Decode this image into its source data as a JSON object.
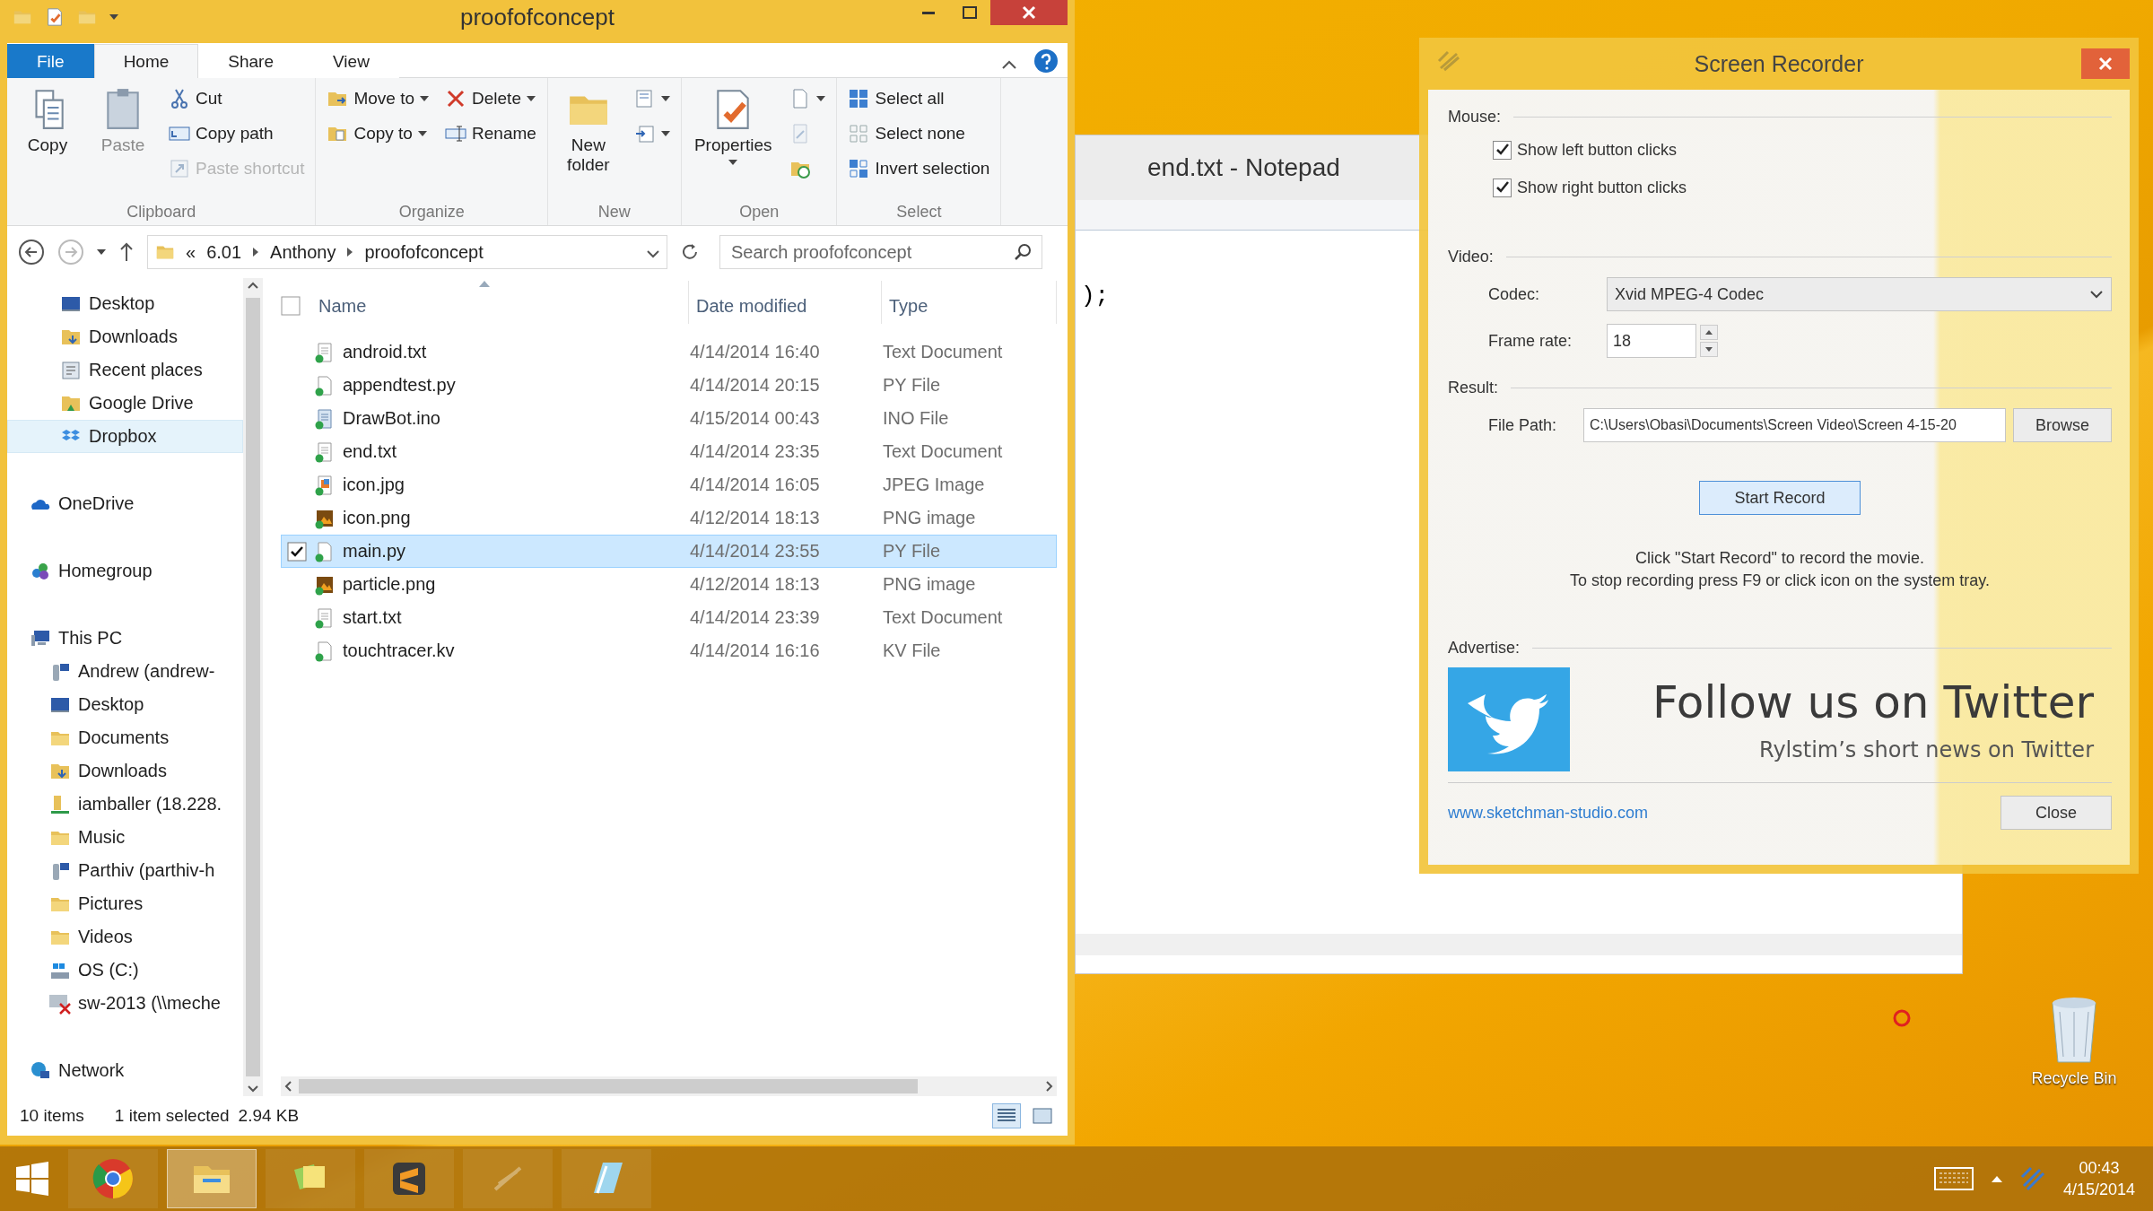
{
  "explorer": {
    "title": "proofofconcept",
    "tabs": [
      {
        "label": "File",
        "selected": false,
        "kind": "file"
      },
      {
        "label": "Home",
        "selected": true,
        "kind": "tab"
      },
      {
        "label": "Share",
        "selected": false,
        "kind": "tab"
      },
      {
        "label": "View",
        "selected": false,
        "kind": "tab"
      }
    ],
    "ribbon": [
      {
        "label": "Clipboard",
        "items": [
          {
            "kind": "large",
            "label": "Copy",
            "disabled": false,
            "dropdown": false
          },
          {
            "kind": "large",
            "label": "Paste",
            "disabled": true,
            "dropdown": false
          },
          {
            "kind": "column",
            "items": [
              {
                "label": "Cut",
                "disabled": false,
                "dropdown": false
              },
              {
                "label": "Copy path",
                "disabled": false,
                "dropdown": false
              },
              {
                "label": "Paste shortcut",
                "disabled": true,
                "dropdown": false
              }
            ]
          }
        ]
      },
      {
        "label": "Organize",
        "items": [
          {
            "kind": "column",
            "items": [
              {
                "label": "Move to",
                "disabled": false,
                "dropdown": true
              },
              {
                "label": "Copy to",
                "disabled": false,
                "dropdown": true
              }
            ]
          },
          {
            "kind": "column",
            "items": [
              {
                "label": "Delete",
                "disabled": false,
                "dropdown": true
              },
              {
                "label": "Rename",
                "disabled": false,
                "dropdown": false
              }
            ]
          }
        ]
      },
      {
        "label": "New",
        "items": [
          {
            "kind": "large",
            "label": "New folder",
            "disabled": false,
            "dropdown": false
          },
          {
            "kind": "column",
            "items": [
              {
                "disabled": false,
                "dropdown": true
              },
              {
                "disabled": false,
                "dropdown": true
              }
            ]
          }
        ]
      },
      {
        "label": "Open",
        "items": [
          {
            "kind": "large",
            "label": "Properties",
            "disabled": false,
            "dropdown": true
          },
          {
            "kind": "column",
            "items": [
              {
                "disabled": false,
                "dropdown": true
              },
              {
                "disabled": true,
                "dropdown": false
              },
              {
                "disabled": false,
                "dropdown": false
              }
            ]
          }
        ]
      },
      {
        "label": "Select",
        "items": [
          {
            "kind": "column",
            "items": [
              {
                "label": "Select all",
                "disabled": false,
                "dropdown": false
              },
              {
                "label": "Select none",
                "disabled": false,
                "dropdown": false
              },
              {
                "label": "Invert selection",
                "disabled": false,
                "dropdown": false
              }
            ]
          }
        ]
      }
    ],
    "address": {
      "overflow": "«",
      "crumbs": [
        "6.01",
        "Anthony",
        "proofofconcept"
      ],
      "search_placeholder": "Search proofofconcept"
    },
    "nav": [
      {
        "children": [
          {
            "label": "Desktop",
            "kind": "desktop",
            "selected": false
          },
          {
            "label": "Downloads",
            "kind": "downloads",
            "selected": false
          },
          {
            "label": "Recent places",
            "kind": "recent",
            "selected": false
          },
          {
            "label": "Google Drive",
            "kind": "gdrive",
            "selected": false
          },
          {
            "label": "Dropbox",
            "kind": "dropbox",
            "selected": true
          }
        ]
      },
      {
        "label": "OneDrive",
        "kind": "cloud",
        "selected": false
      },
      {
        "label": "Homegroup",
        "kind": "homegroup",
        "selected": false
      },
      {
        "label": "This PC",
        "kind": "pc",
        "selected": false,
        "children": [
          {
            "label": "Andrew (andrew-",
            "kind": "share",
            "selected": false
          },
          {
            "label": "Desktop",
            "kind": "desktop",
            "selected": false
          },
          {
            "label": "Documents",
            "kind": "folder",
            "selected": false
          },
          {
            "label": "Downloads",
            "kind": "downloads",
            "selected": false
          },
          {
            "label": "iamballer (18.228.",
            "kind": "netfolder",
            "selected": false
          },
          {
            "label": "Music",
            "kind": "folder",
            "selected": false
          },
          {
            "label": "Parthiv (parthiv-h",
            "kind": "share",
            "selected": false
          },
          {
            "label": "Pictures",
            "kind": "folder",
            "selected": false
          },
          {
            "label": "Videos",
            "kind": "folder",
            "selected": false
          },
          {
            "label": "OS (C:)",
            "kind": "drive",
            "selected": false
          },
          {
            "label": "sw-2013 (\\\\meche",
            "kind": "lostdrive",
            "selected": false
          }
        ]
      },
      {
        "label": "Network",
        "kind": "network",
        "selected": false
      }
    ],
    "columns": [
      {
        "label": "Name",
        "sorted": true
      },
      {
        "label": "Date modified",
        "sorted": false
      },
      {
        "label": "Type",
        "sorted": false
      }
    ],
    "rows": [
      {
        "name": "android.txt",
        "date": "4/14/2014 16:40",
        "type": "Text Document",
        "kind": "text",
        "selected": false
      },
      {
        "name": "appendtest.py",
        "date": "4/14/2014 20:15",
        "type": "PY File",
        "kind": "blank",
        "selected": false
      },
      {
        "name": "DrawBot.ino",
        "date": "4/15/2014 00:43",
        "type": "INO File",
        "kind": "code",
        "selected": false
      },
      {
        "name": "end.txt",
        "date": "4/14/2014 23:35",
        "type": "Text Document",
        "kind": "text",
        "selected": false
      },
      {
        "name": "icon.jpg",
        "date": "4/14/2014 16:05",
        "type": "JPEG Image",
        "kind": "photo",
        "selected": false
      },
      {
        "name": "icon.png",
        "date": "4/12/2014 18:13",
        "type": "PNG image",
        "kind": "image",
        "selected": false
      },
      {
        "name": "main.py",
        "date": "4/14/2014 23:55",
        "type": "PY File",
        "kind": "blank",
        "selected": true
      },
      {
        "name": "particle.png",
        "date": "4/12/2014 18:13",
        "type": "PNG image",
        "kind": "image",
        "selected": false
      },
      {
        "name": "start.txt",
        "date": "4/14/2014 23:39",
        "type": "Text Document",
        "kind": "text",
        "selected": false
      },
      {
        "name": "touchtracer.kv",
        "date": "4/14/2014 16:16",
        "type": "KV File",
        "kind": "blank",
        "selected": false
      }
    ],
    "status": {
      "count": "10 items",
      "selection": "1 item selected",
      "size": "2.94 KB"
    }
  },
  "notepad": {
    "title": "end.txt - Notepad",
    "text": ");"
  },
  "recorder": {
    "title": "Screen Recorder",
    "mouse_label": "Mouse:",
    "checkboxes": [
      {
        "label": "Show left button clicks",
        "checked": true
      },
      {
        "label": "Show right button clicks",
        "checked": true
      }
    ],
    "video_label": "Video:",
    "codec_label": "Codec:",
    "codec": "Xvid MPEG-4 Codec",
    "frame_rate_label": "Frame rate:",
    "frame_rate": "18",
    "result_label": "Result:",
    "file_path_label": "File Path:",
    "file_path": "C:\\Users\\Obasi\\Documents\\Screen Video\\Screen 4-15-20",
    "browse": "Browse",
    "start": "Start Record",
    "hint_lines": [
      "Click \"Start Record\" to record the movie.",
      "To stop recording press F9 or click icon on the system tray."
    ],
    "advertise_label": "Advertise:",
    "ad_title": "Follow us on Twitter",
    "ad_subtitle": "Rylstim’s short news on Twitter",
    "link": "www.sketchman-studio.com",
    "close": "Close"
  },
  "desktop": {
    "recycle_bin": "Recycle Bin"
  },
  "taskbar": {
    "apps": [
      {
        "kind": "chrome",
        "active": false
      },
      {
        "kind": "explorer",
        "active": true
      },
      {
        "kind": "notes",
        "active": false
      },
      {
        "kind": "sublime",
        "active": false
      },
      {
        "kind": "faded",
        "active": false
      },
      {
        "kind": "notepad",
        "active": false
      }
    ],
    "time": "00:43",
    "date": "4/15/2014"
  }
}
